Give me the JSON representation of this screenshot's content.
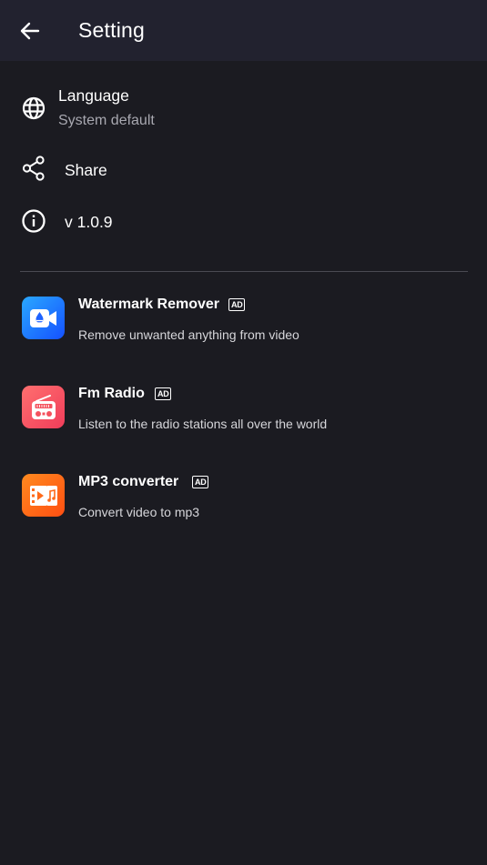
{
  "app_bar": {
    "title": "Setting",
    "back_icon": "arrow-left-icon"
  },
  "settings": {
    "language": {
      "icon": "globe-icon",
      "title": "Language",
      "value": "System default"
    },
    "share": {
      "icon": "share-icon",
      "title": "Share"
    },
    "version": {
      "icon": "info-icon",
      "title": "v 1.0.9"
    }
  },
  "promoted_apps": [
    {
      "name": "Watermark Remover",
      "badge": "AD",
      "description": "Remove unwanted anything from video",
      "icon": "watermark-remover-app-icon",
      "color": "#1e63ff"
    },
    {
      "name": "Fm Radio",
      "badge": "AD",
      "description": "Listen to the radio stations all over the world",
      "icon": "radio-app-icon",
      "color": "#f4525e"
    },
    {
      "name": "MP3 converter",
      "badge": "AD",
      "description": "Convert video to mp3",
      "icon": "mp3-converter-app-icon",
      "color": "#ff6a1a"
    }
  ],
  "colors": {
    "background": "#1b1b21",
    "app_bar": "#22222f",
    "subtitle": "#a8a8b0"
  }
}
